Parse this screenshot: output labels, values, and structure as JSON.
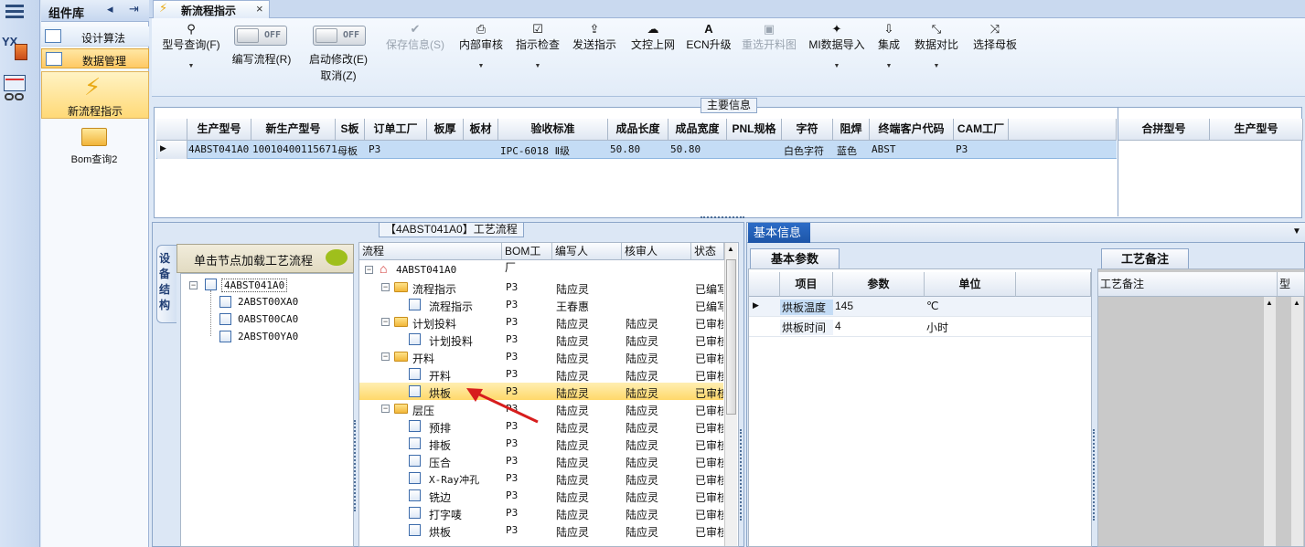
{
  "left_strip": {
    "menu_icon": "hamburger-icon",
    "logo_text": "YX"
  },
  "sidebar": {
    "title": "组件库",
    "items": [
      {
        "label": "设计算法",
        "active": false
      },
      {
        "label": "数据管理",
        "active": true
      }
    ],
    "tiles": [
      {
        "label": "新流程指示",
        "icon": "lightning-icon",
        "active": true
      },
      {
        "label": "Bom查询2",
        "icon": "folder-open-icon",
        "active": false
      }
    ]
  },
  "tab": {
    "label": "新流程指示",
    "close": "×"
  },
  "toolbar": {
    "buttons": [
      {
        "label": "型号查询(F)",
        "icon": "search-icon",
        "glyph": "🔍",
        "disabled": false,
        "dropdown": true
      },
      {
        "label": "编写流程(R)",
        "toggle": "OFF"
      },
      {
        "label": "启动修改(E)",
        "sub": "取消(Z)",
        "toggle": "OFF"
      },
      {
        "label": "保存信息(S)",
        "icon": "check-icon",
        "glyph": "✔",
        "disabled": true
      },
      {
        "label": "内部审核",
        "icon": "print-icon",
        "glyph": "⎙",
        "disabled": false,
        "dropdown": true
      },
      {
        "label": "指示检查",
        "icon": "checkbox-icon",
        "glyph": "☑",
        "disabled": false,
        "dropdown": true
      },
      {
        "label": "发送指示",
        "icon": "upload-icon",
        "glyph": "⇪",
        "disabled": false
      },
      {
        "label": "文控上网",
        "icon": "cloud-upload-icon",
        "glyph": "☁",
        "disabled": false
      },
      {
        "label": "ECN升级",
        "icon": "font-icon",
        "glyph": "A",
        "disabled": false
      },
      {
        "label": "重选开料图",
        "icon": "image-icon",
        "glyph": "▣",
        "disabled": true
      },
      {
        "label": "MI数据导入",
        "icon": "magic-icon",
        "glyph": "✦",
        "disabled": false,
        "dropdown": true
      },
      {
        "label": "集成",
        "icon": "download-icon",
        "glyph": "⇩",
        "disabled": false,
        "dropdown": true
      },
      {
        "label": "数据对比",
        "icon": "compress-icon",
        "glyph": "⤡",
        "disabled": false,
        "dropdown": true
      },
      {
        "label": "选择母板",
        "icon": "random-icon",
        "glyph": "⤨",
        "disabled": false
      }
    ]
  },
  "main_info": {
    "title": "主要信息",
    "columns": [
      "生产型号",
      "新生产型号",
      "S板",
      "订单工厂",
      "板厚",
      "板材",
      "验收标准",
      "成品长度",
      "成品宽度",
      "PNL规格",
      "字符",
      "阻焊",
      "终端客户代码",
      "CAM工厂"
    ],
    "row": [
      "4ABST041A0",
      "10010400115671",
      "母板",
      "P3",
      "",
      "",
      "IPC-6018 Ⅱ级",
      "50.80",
      "50.80",
      "",
      "白色字符",
      "蓝色",
      "ABST",
      "P3"
    ],
    "side_columns": [
      "合拼型号",
      "生产型号"
    ]
  },
  "flow": {
    "title": "【4ABST041A0】工艺流程",
    "vtab": "设备结构",
    "hint": "单击节点加载工艺流程",
    "left_tree": {
      "root": "4ABST041A0",
      "children": [
        "2ABST00XA0",
        "0ABST00CA0",
        "2ABST00YA0"
      ]
    },
    "columns": [
      "流程",
      "BOM工厂",
      "编写人",
      "核审人",
      "状态"
    ],
    "rows": [
      {
        "level": 0,
        "type": "home",
        "name": "4ABST041A0",
        "bom": "",
        "writer": "",
        "reviewer": "",
        "status": "",
        "expander": "−"
      },
      {
        "level": 1,
        "type": "folder",
        "name": "流程指示",
        "bom": "P3",
        "writer": "陆应灵",
        "reviewer": "",
        "status": "已编写",
        "expander": "−"
      },
      {
        "level": 2,
        "type": "doc",
        "name": "流程指示",
        "bom": "P3",
        "writer": "王春惠",
        "reviewer": "",
        "status": "已编写"
      },
      {
        "level": 1,
        "type": "folder",
        "name": "计划投料",
        "bom": "P3",
        "writer": "陆应灵",
        "reviewer": "陆应灵",
        "status": "已审核",
        "expander": "−"
      },
      {
        "level": 2,
        "type": "doc",
        "name": "计划投料",
        "bom": "P3",
        "writer": "陆应灵",
        "reviewer": "陆应灵",
        "status": "已审核"
      },
      {
        "level": 1,
        "type": "folder",
        "name": "开料",
        "bom": "P3",
        "writer": "陆应灵",
        "reviewer": "陆应灵",
        "status": "已审核",
        "expander": "−"
      },
      {
        "level": 2,
        "type": "doc",
        "name": "开料",
        "bom": "P3",
        "writer": "陆应灵",
        "reviewer": "陆应灵",
        "status": "已审核"
      },
      {
        "level": 2,
        "type": "doc",
        "name": "烘板",
        "bom": "P3",
        "writer": "陆应灵",
        "reviewer": "陆应灵",
        "status": "已审核",
        "selected": true
      },
      {
        "level": 1,
        "type": "folder",
        "name": "层压",
        "bom": "P3",
        "writer": "陆应灵",
        "reviewer": "陆应灵",
        "status": "已审核",
        "expander": "−"
      },
      {
        "level": 2,
        "type": "doc",
        "name": "预排",
        "bom": "P3",
        "writer": "陆应灵",
        "reviewer": "陆应灵",
        "status": "已审核"
      },
      {
        "level": 2,
        "type": "doc",
        "name": "排板",
        "bom": "P3",
        "writer": "陆应灵",
        "reviewer": "陆应灵",
        "status": "已审核"
      },
      {
        "level": 2,
        "type": "doc",
        "name": "压合",
        "bom": "P3",
        "writer": "陆应灵",
        "reviewer": "陆应灵",
        "status": "已审核"
      },
      {
        "level": 2,
        "type": "doc",
        "name": "X-Ray冲孔",
        "bom": "P3",
        "writer": "陆应灵",
        "reviewer": "陆应灵",
        "status": "已审核"
      },
      {
        "level": 2,
        "type": "doc",
        "name": "铣边",
        "bom": "P3",
        "writer": "陆应灵",
        "reviewer": "陆应灵",
        "status": "已审核"
      },
      {
        "level": 2,
        "type": "doc",
        "name": "打字唛",
        "bom": "P3",
        "writer": "陆应灵",
        "reviewer": "陆应灵",
        "status": "已审核"
      },
      {
        "level": 2,
        "type": "doc",
        "name": "烘板",
        "bom": "P3",
        "writer": "陆应灵",
        "reviewer": "陆应灵",
        "status": "已审核"
      }
    ]
  },
  "basic_info": {
    "tab": "基本信息",
    "params_tab": "基本参数",
    "columns": [
      "项目",
      "参数",
      "单位"
    ],
    "rows": [
      {
        "item": "烘板温度",
        "value": "145",
        "unit": "℃"
      },
      {
        "item": "烘板时间",
        "value": "4",
        "unit": "小时"
      }
    ],
    "remark_tab": "工艺备注",
    "remark_columns": [
      "工艺备注",
      "型"
    ]
  },
  "colors": {
    "accent_blue": "#1d55a8",
    "selection_yellow": "#ffd86a",
    "row_selected_blue": "#c4dcf5",
    "annotation_arrow": "#d71d1d"
  }
}
